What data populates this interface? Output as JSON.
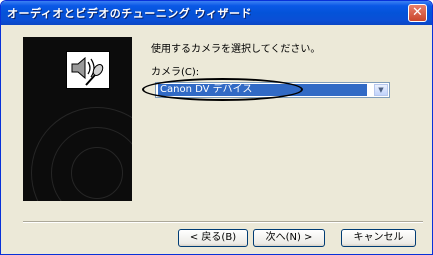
{
  "window": {
    "title": "オーディオとビデオのチューニング ウィザード",
    "close_glyph": "✕"
  },
  "main": {
    "prompt": "使用するカメラを選択してください。",
    "camera_label": "カメラ(C):",
    "camera_select": {
      "value": "Canon DV デバイス",
      "arrow_glyph": "▼"
    }
  },
  "buttons": {
    "back": "< 戻る(B)",
    "next": "次へ(N) >",
    "cancel": "キャンセル"
  },
  "icons": {
    "wizard": "speaker-microphone-icon"
  },
  "colors": {
    "title_bar": "#0a58e6",
    "selection": "#316ac5",
    "side_panel": "#0c0c0c"
  }
}
